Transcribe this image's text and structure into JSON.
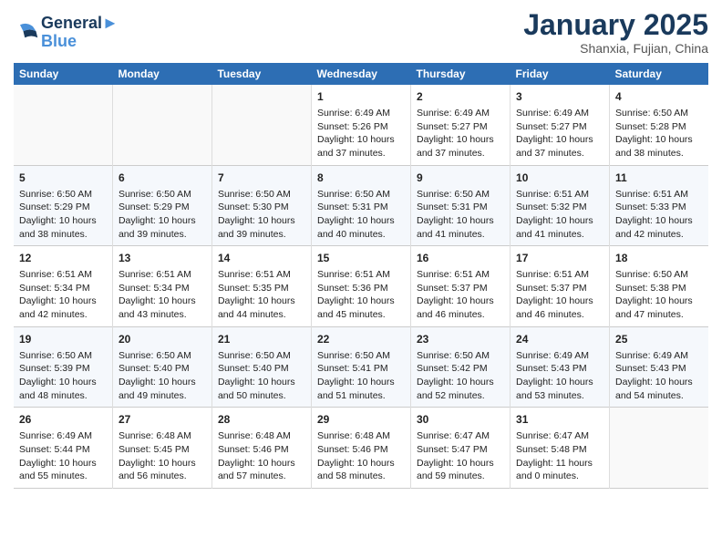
{
  "header": {
    "logo_line1": "General",
    "logo_line2": "Blue",
    "title": "January 2025",
    "subtitle": "Shanxia, Fujian, China"
  },
  "days_of_week": [
    "Sunday",
    "Monday",
    "Tuesday",
    "Wednesday",
    "Thursday",
    "Friday",
    "Saturday"
  ],
  "weeks": [
    {
      "cells": [
        {
          "day": "",
          "info": ""
        },
        {
          "day": "",
          "info": ""
        },
        {
          "day": "",
          "info": ""
        },
        {
          "day": "1",
          "info": "Sunrise: 6:49 AM\nSunset: 5:26 PM\nDaylight: 10 hours\nand 37 minutes."
        },
        {
          "day": "2",
          "info": "Sunrise: 6:49 AM\nSunset: 5:27 PM\nDaylight: 10 hours\nand 37 minutes."
        },
        {
          "day": "3",
          "info": "Sunrise: 6:49 AM\nSunset: 5:27 PM\nDaylight: 10 hours\nand 37 minutes."
        },
        {
          "day": "4",
          "info": "Sunrise: 6:50 AM\nSunset: 5:28 PM\nDaylight: 10 hours\nand 38 minutes."
        }
      ]
    },
    {
      "cells": [
        {
          "day": "5",
          "info": "Sunrise: 6:50 AM\nSunset: 5:29 PM\nDaylight: 10 hours\nand 38 minutes."
        },
        {
          "day": "6",
          "info": "Sunrise: 6:50 AM\nSunset: 5:29 PM\nDaylight: 10 hours\nand 39 minutes."
        },
        {
          "day": "7",
          "info": "Sunrise: 6:50 AM\nSunset: 5:30 PM\nDaylight: 10 hours\nand 39 minutes."
        },
        {
          "day": "8",
          "info": "Sunrise: 6:50 AM\nSunset: 5:31 PM\nDaylight: 10 hours\nand 40 minutes."
        },
        {
          "day": "9",
          "info": "Sunrise: 6:50 AM\nSunset: 5:31 PM\nDaylight: 10 hours\nand 41 minutes."
        },
        {
          "day": "10",
          "info": "Sunrise: 6:51 AM\nSunset: 5:32 PM\nDaylight: 10 hours\nand 41 minutes."
        },
        {
          "day": "11",
          "info": "Sunrise: 6:51 AM\nSunset: 5:33 PM\nDaylight: 10 hours\nand 42 minutes."
        }
      ]
    },
    {
      "cells": [
        {
          "day": "12",
          "info": "Sunrise: 6:51 AM\nSunset: 5:34 PM\nDaylight: 10 hours\nand 42 minutes."
        },
        {
          "day": "13",
          "info": "Sunrise: 6:51 AM\nSunset: 5:34 PM\nDaylight: 10 hours\nand 43 minutes."
        },
        {
          "day": "14",
          "info": "Sunrise: 6:51 AM\nSunset: 5:35 PM\nDaylight: 10 hours\nand 44 minutes."
        },
        {
          "day": "15",
          "info": "Sunrise: 6:51 AM\nSunset: 5:36 PM\nDaylight: 10 hours\nand 45 minutes."
        },
        {
          "day": "16",
          "info": "Sunrise: 6:51 AM\nSunset: 5:37 PM\nDaylight: 10 hours\nand 46 minutes."
        },
        {
          "day": "17",
          "info": "Sunrise: 6:51 AM\nSunset: 5:37 PM\nDaylight: 10 hours\nand 46 minutes."
        },
        {
          "day": "18",
          "info": "Sunrise: 6:50 AM\nSunset: 5:38 PM\nDaylight: 10 hours\nand 47 minutes."
        }
      ]
    },
    {
      "cells": [
        {
          "day": "19",
          "info": "Sunrise: 6:50 AM\nSunset: 5:39 PM\nDaylight: 10 hours\nand 48 minutes."
        },
        {
          "day": "20",
          "info": "Sunrise: 6:50 AM\nSunset: 5:40 PM\nDaylight: 10 hours\nand 49 minutes."
        },
        {
          "day": "21",
          "info": "Sunrise: 6:50 AM\nSunset: 5:40 PM\nDaylight: 10 hours\nand 50 minutes."
        },
        {
          "day": "22",
          "info": "Sunrise: 6:50 AM\nSunset: 5:41 PM\nDaylight: 10 hours\nand 51 minutes."
        },
        {
          "day": "23",
          "info": "Sunrise: 6:50 AM\nSunset: 5:42 PM\nDaylight: 10 hours\nand 52 minutes."
        },
        {
          "day": "24",
          "info": "Sunrise: 6:49 AM\nSunset: 5:43 PM\nDaylight: 10 hours\nand 53 minutes."
        },
        {
          "day": "25",
          "info": "Sunrise: 6:49 AM\nSunset: 5:43 PM\nDaylight: 10 hours\nand 54 minutes."
        }
      ]
    },
    {
      "cells": [
        {
          "day": "26",
          "info": "Sunrise: 6:49 AM\nSunset: 5:44 PM\nDaylight: 10 hours\nand 55 minutes."
        },
        {
          "day": "27",
          "info": "Sunrise: 6:48 AM\nSunset: 5:45 PM\nDaylight: 10 hours\nand 56 minutes."
        },
        {
          "day": "28",
          "info": "Sunrise: 6:48 AM\nSunset: 5:46 PM\nDaylight: 10 hours\nand 57 minutes."
        },
        {
          "day": "29",
          "info": "Sunrise: 6:48 AM\nSunset: 5:46 PM\nDaylight: 10 hours\nand 58 minutes."
        },
        {
          "day": "30",
          "info": "Sunrise: 6:47 AM\nSunset: 5:47 PM\nDaylight: 10 hours\nand 59 minutes."
        },
        {
          "day": "31",
          "info": "Sunrise: 6:47 AM\nSunset: 5:48 PM\nDaylight: 11 hours\nand 0 minutes."
        },
        {
          "day": "",
          "info": ""
        }
      ]
    }
  ]
}
